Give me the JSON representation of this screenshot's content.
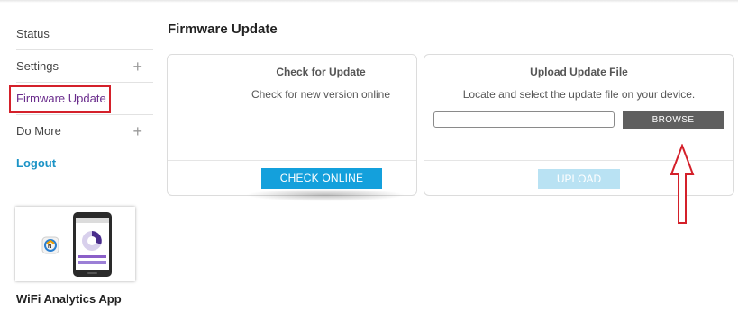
{
  "sidebar": {
    "items": [
      {
        "label": "Status",
        "has_expand": false
      },
      {
        "label": "Settings",
        "has_expand": true
      },
      {
        "label": "Firmware Update",
        "has_expand": false,
        "active": true
      },
      {
        "label": "Do More",
        "has_expand": true
      },
      {
        "label": "Logout",
        "has_expand": false
      }
    ],
    "expand_glyph": "+",
    "app_title": "WiFi Analytics App"
  },
  "main": {
    "title": "Firmware Update",
    "check_card": {
      "title": "Check for Update",
      "description": "Check for new version online",
      "button_label": "CHECK ONLINE"
    },
    "upload_card": {
      "title": "Upload Update File",
      "description": "Locate and select the update file on your device.",
      "file_value": "",
      "browse_label": "BROWSE",
      "upload_label": "UPLOAD"
    }
  },
  "colors": {
    "active_nav": "#6a2c8c",
    "logout": "#1b93c6",
    "primary_button": "#14a0dc",
    "disabled_button": "#b9e2f3",
    "browse_button": "#5f5f5f",
    "annotation": "#d4202a"
  },
  "icons": {
    "expand": "plus-icon",
    "annotation_arrow": "up-arrow-icon",
    "app_logo": "netgear-logo-icon",
    "phone": "phone-icon"
  }
}
